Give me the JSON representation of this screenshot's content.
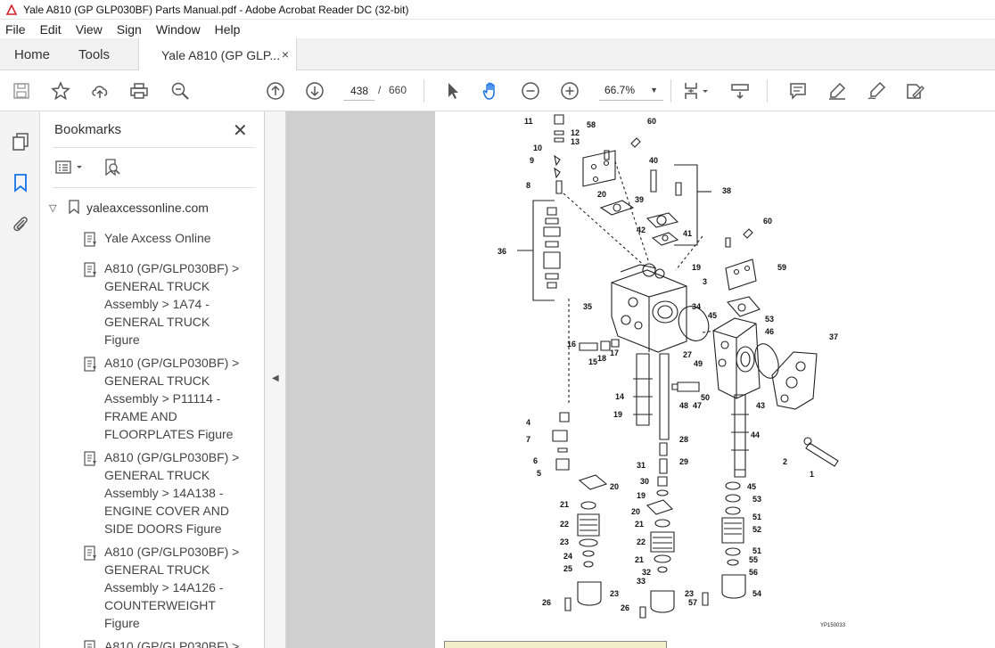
{
  "window": {
    "title": "Yale A810 (GP GLP030BF) Parts Manual.pdf - Adobe Acrobat Reader DC (32-bit)"
  },
  "menu": [
    "File",
    "Edit",
    "View",
    "Sign",
    "Window",
    "Help"
  ],
  "tabs": {
    "home": "Home",
    "tools": "Tools",
    "document": "Yale A810 (GP GLP...",
    "close_glyph": "×"
  },
  "toolbar": {
    "current_page": "438",
    "separator": "/",
    "total_pages": "660",
    "zoom": "66.7%"
  },
  "bookmarks": {
    "title": "Bookmarks",
    "close_glyph": "✕",
    "root": "yaleaxcessonline.com",
    "items": [
      "Yale Axcess Online",
      "A810 (GP/GLP030BF) > GENERAL TRUCK Assembly > 1A74 - GENERAL TRUCK Figure",
      "A810 (GP/GLP030BF) > GENERAL TRUCK Assembly > P11114 - FRAME AND FLOORPLATES Figure",
      "A810 (GP/GLP030BF) > GENERAL TRUCK Assembly > 14A138 - ENGINE COVER AND SIDE DOORS Figure",
      "A810 (GP/GLP030BF) > GENERAL TRUCK Assembly > 14A126 - COUNTERWEIGHT Figure",
      "A810 (GP/GLP030BF) >"
    ]
  },
  "figure": {
    "reference": "YP150033",
    "callouts": [
      "1",
      "2",
      "3",
      "4",
      "5",
      "6",
      "7",
      "8",
      "9",
      "10",
      "11",
      "12",
      "13",
      "14",
      "15",
      "16",
      "17",
      "18",
      "19",
      "20",
      "21",
      "22",
      "23",
      "24",
      "25",
      "26",
      "27",
      "28",
      "29",
      "30",
      "31",
      "32",
      "33",
      "34",
      "35",
      "36",
      "37",
      "38",
      "39",
      "40",
      "41",
      "42",
      "43",
      "44",
      "45",
      "46",
      "47",
      "48",
      "49",
      "50",
      "51",
      "52",
      "53",
      "54",
      "55",
      "56",
      "57",
      "58",
      "59",
      "60"
    ]
  },
  "colors": {
    "accent": "#1473e6",
    "titlebar_icon": "#d4202c",
    "doc_bg": "#cfcfcf"
  }
}
